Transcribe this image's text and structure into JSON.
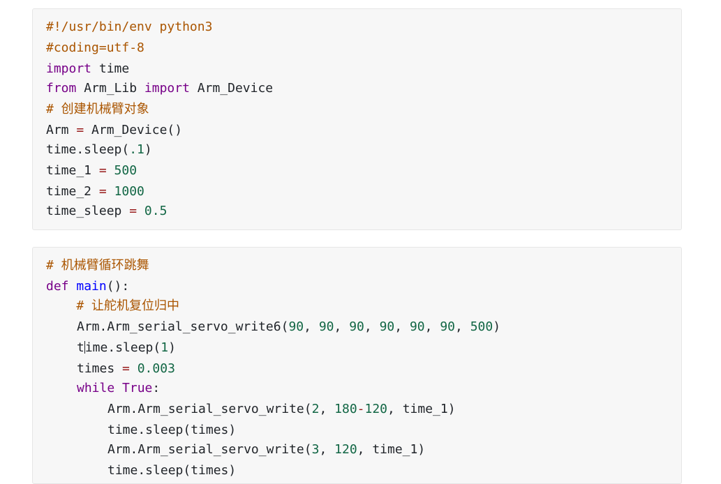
{
  "block1": {
    "lines": [
      "#!/usr/bin/env python3",
      "#coding=utf-8",
      "import time",
      "from Arm_Lib import Arm_Device",
      "# 创建机械臂对象",
      "Arm = Arm_Device()",
      "time.sleep(.1)",
      "time_1 = 500",
      "time_2 = 1000",
      "time_sleep = 0.5"
    ]
  },
  "block2": {
    "lines": [
      "# 机械臂循环跳舞",
      "def main():",
      "    # 让舵机复位归中",
      "Arm.Arm_serial_servo_write6(90, 90, 90, 90, 90, 90, 500)",
      "time.sleep(1)",
      "times = 0.003",
      "while True:",
      "Arm.Arm_serial_servo_write(2, 180-120, time_1)",
      "time.sleep(times)",
      "Arm.Arm_serial_servo_write(3, 120, time_1)",
      "time.sleep(times)"
    ]
  },
  "colors": {
    "comment": "#aa5500",
    "keyword": "#770088",
    "number": "#116644",
    "function": "#0000ff",
    "background": "#f7f7f7"
  }
}
